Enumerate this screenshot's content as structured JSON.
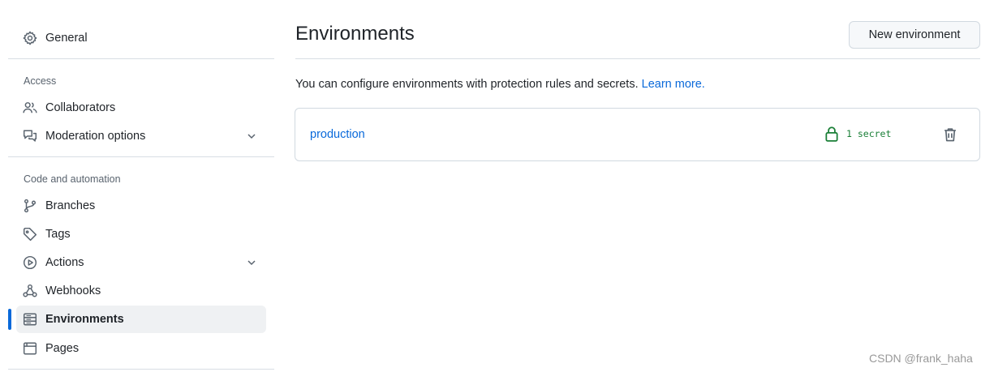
{
  "sidebar": {
    "general": "General",
    "sections": [
      {
        "heading": "Access",
        "items": [
          {
            "label": "Collaborators",
            "icon": "people-icon"
          },
          {
            "label": "Moderation options",
            "icon": "comment-discussion-icon",
            "expandable": true
          }
        ]
      },
      {
        "heading": "Code and automation",
        "items": [
          {
            "label": "Branches",
            "icon": "git-branch-icon"
          },
          {
            "label": "Tags",
            "icon": "tag-icon"
          },
          {
            "label": "Actions",
            "icon": "play-icon",
            "expandable": true
          },
          {
            "label": "Webhooks",
            "icon": "webhook-icon"
          },
          {
            "label": "Environments",
            "icon": "server-icon",
            "active": true
          },
          {
            "label": "Pages",
            "icon": "browser-icon"
          }
        ]
      }
    ]
  },
  "main": {
    "title": "Environments",
    "new_button": "New environment",
    "description": "You can configure environments with protection rules and secrets.",
    "learn_more": "Learn more.",
    "environments": [
      {
        "name": "production",
        "secrets": "1 secret"
      }
    ]
  },
  "watermark": "CSDN @frank_haha",
  "colors": {
    "accent": "#0969da",
    "success": "#1a7f37",
    "active_bg": "#eff1f3"
  }
}
